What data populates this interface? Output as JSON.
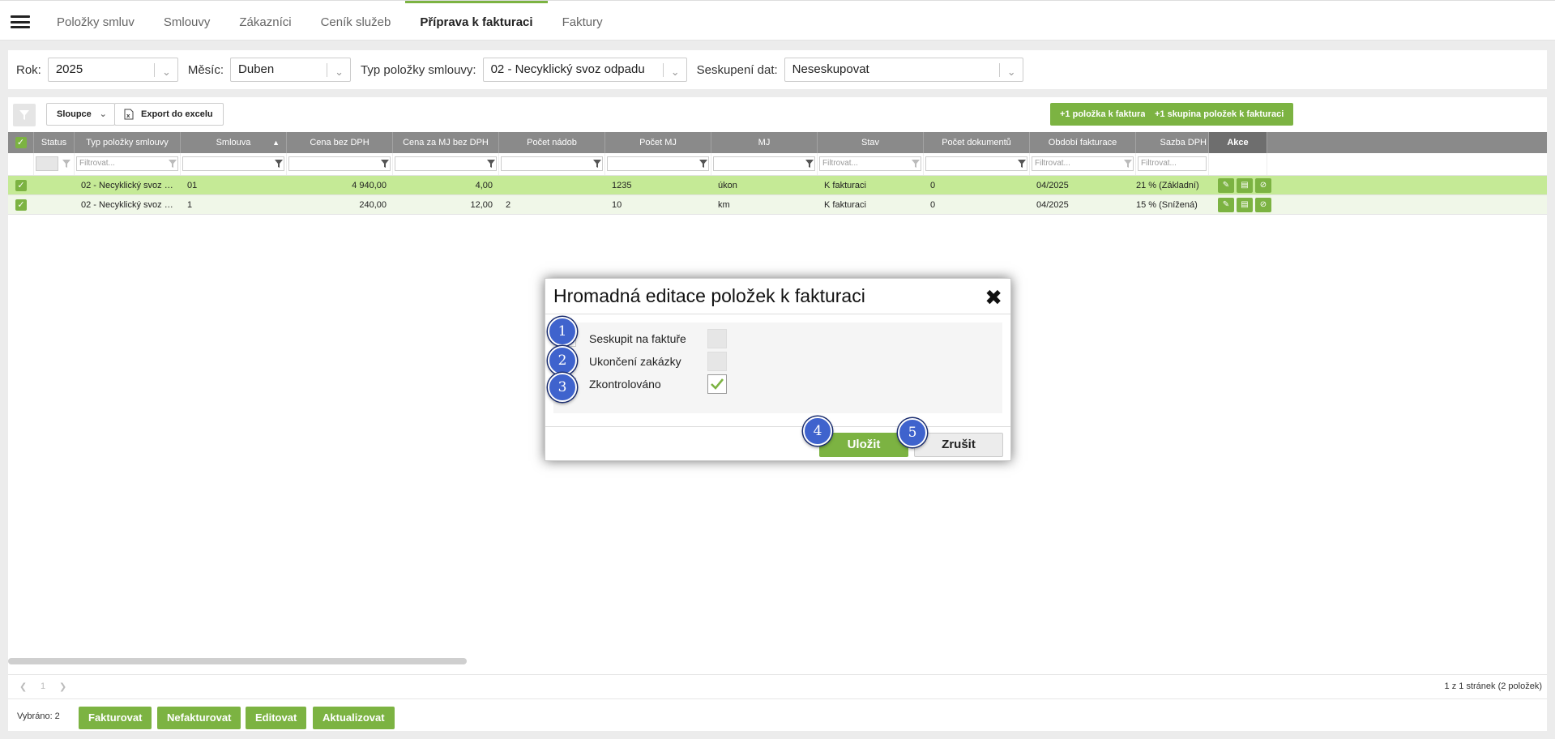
{
  "nav": {
    "tabs": [
      "Položky smluv",
      "Smlouvy",
      "Zákazníci",
      "Ceník služeb",
      "Příprava k fakturaci",
      "Faktury"
    ],
    "active_index": 4
  },
  "filters": {
    "year_label": "Rok:",
    "year_value": "2025",
    "month_label": "Měsíc:",
    "month_value": "Duben",
    "type_label": "Typ položky smlouvy:",
    "type_value": "02 - Necyklický svoz odpadu",
    "group_label": "Seskupení dat:",
    "group_value": "Neseskupovat"
  },
  "toolbar": {
    "columns_label": "Sloupce",
    "export_label": "Export do excelu",
    "add_item_label": "+1 položka k fakturaci",
    "add_group_label": "+1 skupina položek k fakturaci"
  },
  "grid": {
    "headers": [
      "Status",
      "Typ položky smlouvy",
      "Smlouva",
      "Cena bez DPH",
      "Cena za MJ bez DPH",
      "Počet nádob",
      "Počet MJ",
      "MJ",
      "Stav",
      "Počet dokumentů",
      "Období fakturace",
      "Sazba DPH",
      "Akce"
    ],
    "filter_placeholder": "Filtrovat...",
    "rows": [
      [
        "",
        "02 - Necyklický svoz odpa...",
        "01",
        "4 940,00",
        "4,00",
        "",
        "1235",
        "úkon",
        "K fakturaci",
        "0",
        "04/2025",
        "21 % (Základní)"
      ],
      [
        "",
        "02 - Necyklický svoz odpa...",
        "1",
        "240,00",
        "12,00",
        "2",
        "10",
        "km",
        "K fakturaci",
        "0",
        "04/2025",
        "15 % (Snížená)"
      ]
    ]
  },
  "pager": {
    "page": "1",
    "info": "1 z 1 stránek (2 položek)"
  },
  "bottom": {
    "selected": "Vybráno: 2",
    "buttons": [
      "Fakturovat",
      "Nefakturovat",
      "Editovat",
      "Aktualizovat"
    ]
  },
  "modal": {
    "title": "Hromadná editace položek k fakturaci",
    "options": [
      {
        "label": "Seskupit na faktuře",
        "checked": false
      },
      {
        "label": "Ukončení zakázky",
        "checked": false
      },
      {
        "label": "Zkontrolováno",
        "checked": true
      }
    ],
    "save_label": "Uložit",
    "cancel_label": "Zrušit"
  },
  "badges": [
    "1",
    "2",
    "3",
    "4",
    "5"
  ],
  "colors": {
    "accent": "#7cb342",
    "header": "#8a8a8a",
    "row_selected": "#c5ea96",
    "badge": "#3f63cd"
  }
}
